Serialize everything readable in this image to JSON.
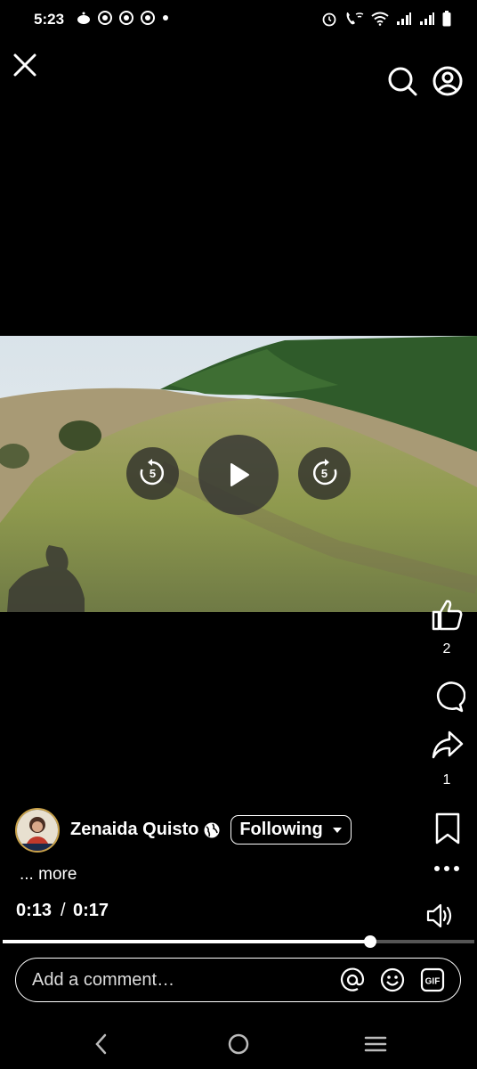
{
  "status_bar": {
    "time": "5:23",
    "left_icons": [
      "reddit-icon",
      "chrome-icon",
      "chrome-icon",
      "chrome-icon",
      "dot-icon"
    ],
    "right_icons": [
      "alarm-icon",
      "wifi-call-icon",
      "wifi-icon",
      "signal-icon",
      "signal-icon",
      "battery-icon"
    ]
  },
  "top_bar": {
    "close_icon": "close-icon",
    "search_icon": "search-icon",
    "profile_icon": "profile-icon"
  },
  "video": {
    "skip_back_label": "5",
    "skip_forward_label": "5",
    "play_icon": "play-icon"
  },
  "actions": {
    "like_count": "2",
    "share_count": "1"
  },
  "author": {
    "name": "Zenaida Quisto",
    "privacy_icon": "globe-icon",
    "follow_label": "Following"
  },
  "caption": {
    "more_label": "... more"
  },
  "playback": {
    "current_time": "0:13",
    "separator": "/",
    "total_time": "0:17",
    "progress": 0.78
  },
  "comment": {
    "placeholder": "Add a comment…",
    "icons": [
      "mention-icon",
      "emoji-icon",
      "gif-icon"
    ]
  },
  "nav_bar": {
    "icons": [
      "back-icon",
      "home-icon",
      "recents-icon"
    ]
  },
  "colors": {
    "background": "#000000",
    "foreground": "#ffffff",
    "track": "#555555"
  }
}
